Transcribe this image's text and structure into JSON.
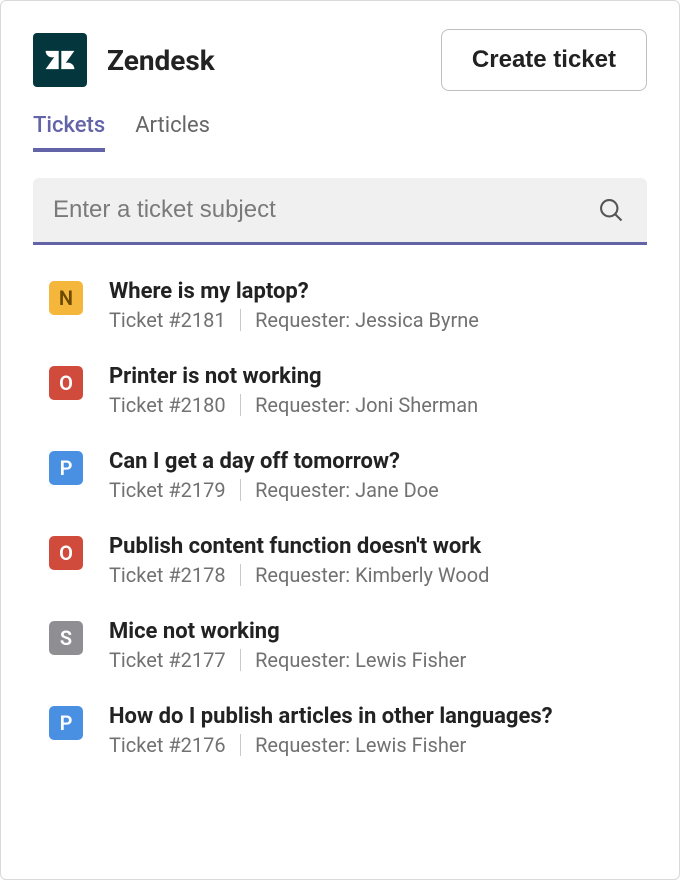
{
  "header": {
    "app_name": "Zendesk",
    "create_button_label": "Create ticket"
  },
  "tabs": [
    {
      "label": "Tickets",
      "active": true
    },
    {
      "label": "Articles",
      "active": false
    }
  ],
  "search": {
    "placeholder": "Enter a ticket subject"
  },
  "status_colors": {
    "N": "#f5b73b",
    "O": "#d14b3d",
    "P": "#4a90e2",
    "S": "#8e8e93"
  },
  "tickets": [
    {
      "status": "N",
      "title": "Where is my laptop?",
      "ticket_label": "Ticket #2181",
      "requester_label": "Requester: Jessica Byrne"
    },
    {
      "status": "O",
      "title": "Printer is not working",
      "ticket_label": "Ticket #2180",
      "requester_label": "Requester: Joni Sherman"
    },
    {
      "status": "P",
      "title": "Can I get a day off tomorrow?",
      "ticket_label": "Ticket #2179",
      "requester_label": "Requester: Jane Doe"
    },
    {
      "status": "O",
      "title": "Publish content function doesn't work",
      "ticket_label": "Ticket #2178",
      "requester_label": "Requester: Kimberly Wood"
    },
    {
      "status": "S",
      "title": "Mice not working",
      "ticket_label": "Ticket #2177",
      "requester_label": "Requester: Lewis Fisher"
    },
    {
      "status": "P",
      "title": "How do I publish articles in other languages?",
      "ticket_label": "Ticket #2176",
      "requester_label": "Requester: Lewis Fisher"
    }
  ]
}
